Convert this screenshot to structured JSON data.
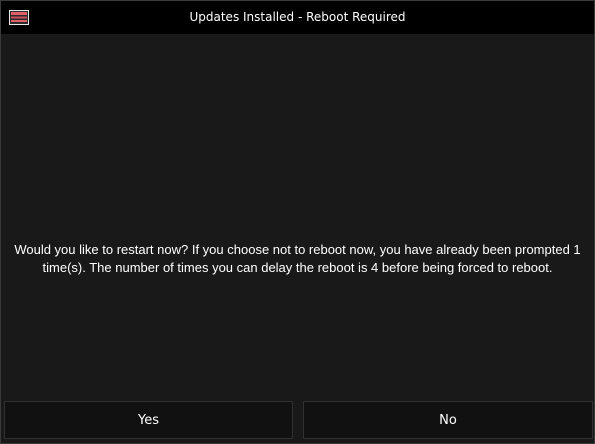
{
  "window": {
    "title": "Updates Installed - Reboot Required",
    "icon": "app-window-icon"
  },
  "message": {
    "text": "Would you like to restart now? If you choose not to reboot now, you have already been prompted 1 time(s). The number of times you can delay the reboot is 4 before being forced to reboot."
  },
  "buttons": {
    "yes_label": "Yes",
    "no_label": "No"
  },
  "colors": {
    "titlebar_bg": "#000000",
    "body_bg": "#191919",
    "button_bg": "#111111",
    "icon_accent": "#e0606a",
    "text": "#ffffff"
  }
}
